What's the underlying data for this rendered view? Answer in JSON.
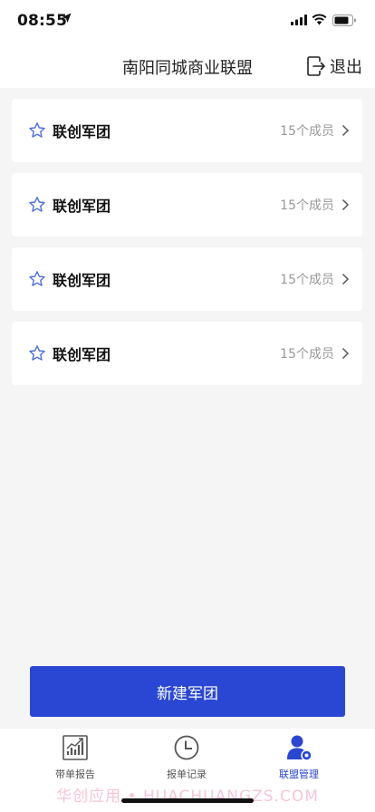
{
  "status_bar": {
    "time": "08:55"
  },
  "header": {
    "title": "南阳同城商业联盟",
    "logout_label": "退出"
  },
  "teams": [
    {
      "name": "联创军团",
      "member_count": "15个成员"
    },
    {
      "name": "联创军团",
      "member_count": "15个成员"
    },
    {
      "name": "联创军团",
      "member_count": "15个成员"
    },
    {
      "name": "联创军团",
      "member_count": "15个成员"
    }
  ],
  "create_button_label": "新建军团",
  "tabs": [
    {
      "label": "带单报告",
      "icon": "chart-icon",
      "active": false
    },
    {
      "label": "报单记录",
      "icon": "clock-icon",
      "active": false
    },
    {
      "label": "联盟管理",
      "icon": "user-settings-icon",
      "active": true
    }
  ],
  "watermark": "华创应用 • HUACHUANGZS.COM",
  "colors": {
    "accent": "#2a47d3",
    "star": "#4a6ee0",
    "background": "#f5f5f6"
  }
}
